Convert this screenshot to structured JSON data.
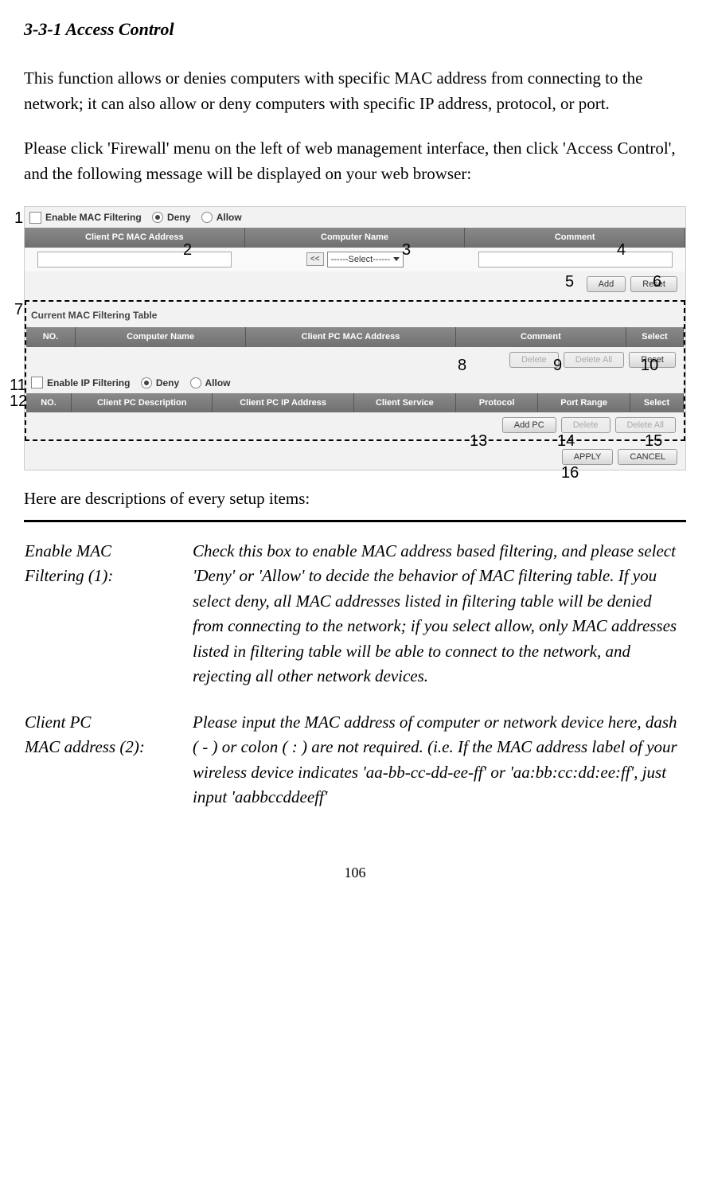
{
  "section_title": "3-3-1 Access Control",
  "intro_p1": "This function allows or denies computers with specific MAC address from connecting to the network; it can also allow or deny computers with specific IP address, protocol, or port.",
  "intro_p2": "Please click 'Firewall' menu on the left of web management interface, then click 'Access Control', and the following message will be displayed on your web browser:",
  "ui": {
    "mac_filter": {
      "enable_label": "Enable MAC Filtering",
      "deny": "Deny",
      "allow": "Allow",
      "headers": {
        "mac": "Client PC MAC Address",
        "name": "Computer Name",
        "comment": "Comment"
      },
      "select_default": "------Select------",
      "add_btn": "Add",
      "reset_btn": "Reset"
    },
    "mac_table": {
      "title": "Current MAC Filtering Table",
      "headers": {
        "no": "NO.",
        "name": "Computer Name",
        "mac": "Client PC MAC Address",
        "comment": "Comment",
        "select": "Select"
      },
      "delete_btn": "Delete",
      "delete_all_btn": "Delete All",
      "reset_btn": "Reset"
    },
    "ip_filter": {
      "enable_label": "Enable IP Filtering",
      "deny": "Deny",
      "allow": "Allow",
      "headers": {
        "no": "NO.",
        "desc": "Client PC Description",
        "ip": "Client PC IP Address",
        "service": "Client Service",
        "protocol": "Protocol",
        "port": "Port Range",
        "select": "Select"
      },
      "add_pc_btn": "Add PC",
      "delete_btn": "Delete",
      "delete_all_btn": "Delete All"
    },
    "apply_btn": "APPLY",
    "cancel_btn": "CANCEL"
  },
  "callouts": {
    "c1": "1",
    "c2": "2",
    "c3": "3",
    "c4": "4",
    "c5": "5",
    "c6": "6",
    "c7": "7",
    "c8": "8",
    "c9": "9",
    "c10": "10",
    "c11": "11",
    "c12": "12",
    "c13": "13",
    "c14": "14",
    "c15": "15",
    "c16": "16"
  },
  "desc_intro": "Here are descriptions of every setup items:",
  "descriptions": [
    {
      "label_l1": "Enable MAC",
      "label_l2": "Filtering (1):",
      "text": "Check this box to enable MAC address based filtering, and please select 'Deny' or 'Allow' to decide the behavior of MAC filtering table. If you select deny, all MAC addresses listed in filtering table will be denied from connecting to the network; if you select allow, only MAC addresses listed in filtering table will be able to connect to the network, and rejecting all other network devices."
    },
    {
      "label_l1": "Client PC",
      "label_l2": "MAC address (2):",
      "text": "Please input the MAC address of computer or network device here, dash ( - ) or colon ( : ) are not required. (i.e. If the MAC address label of your wireless device indicates 'aa-bb-cc-dd-ee-ff' or 'aa:bb:cc:dd:ee:ff', just input 'aabbccddeeff'"
    }
  ],
  "page_number": "106"
}
